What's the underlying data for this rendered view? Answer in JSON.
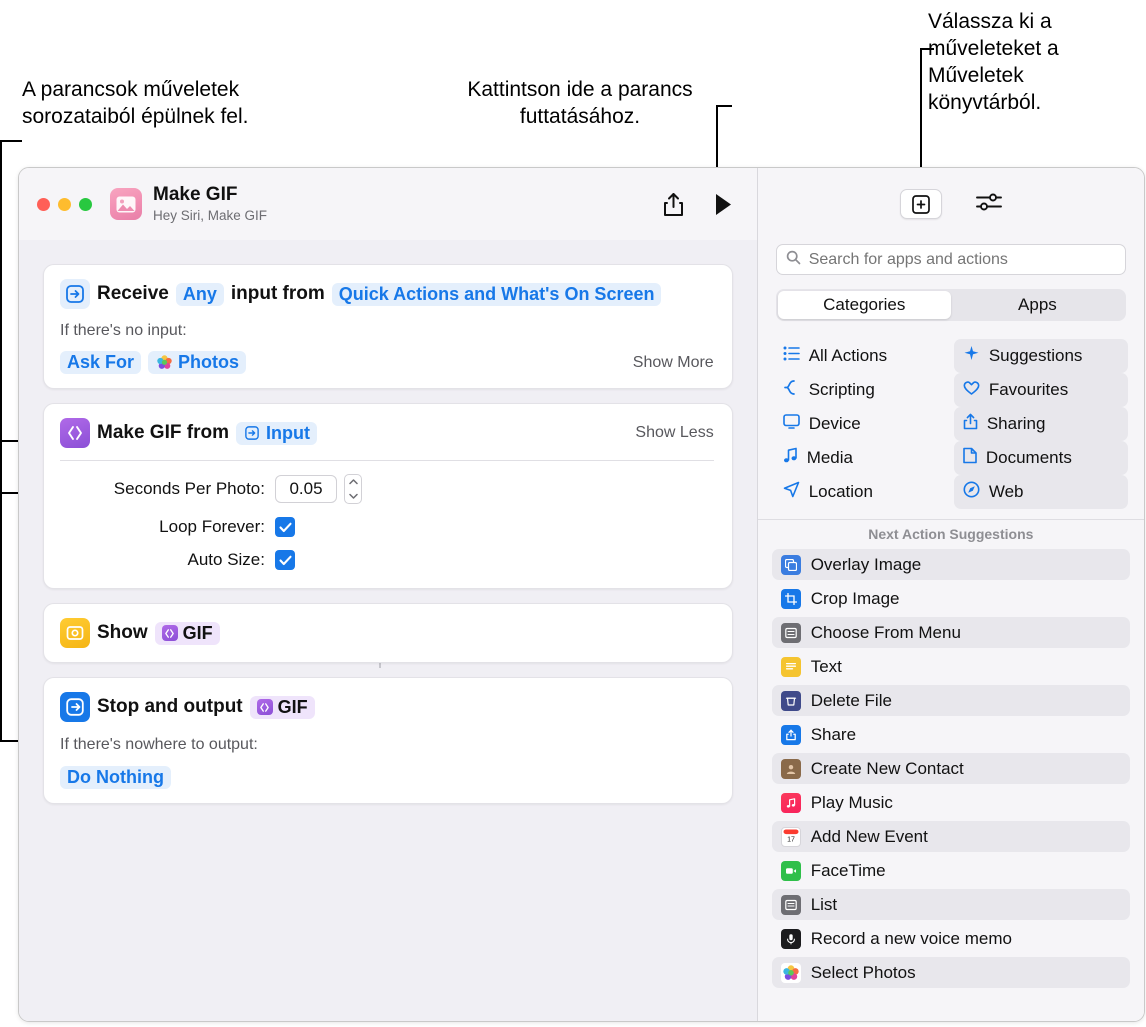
{
  "callouts": {
    "left": "A parancsok műveletek sorozataiból épülnek fel.",
    "middle": "Kattintson ide a parancs futtatásához.",
    "right": "Válassza ki a műveleteket a Műveletek könyvtárból."
  },
  "window": {
    "title": "Make GIF",
    "subtitle": "Hey Siri, Make GIF",
    "icons": {
      "share": "share-icon",
      "run": "play-icon",
      "app": "make-gif-app-icon"
    }
  },
  "actions": [
    {
      "id": "receive",
      "icon": "receive-input-icon",
      "title": "Receive",
      "token1": "Any",
      "mid": "input from",
      "token2": "Quick Actions and What's On Screen",
      "sub_label": "If there's no input:",
      "chip1": "Ask For",
      "chip2": "Photos",
      "toggle": "Show More"
    },
    {
      "id": "make-gif",
      "icon": "make-gif-icon",
      "title": "Make GIF from",
      "token": "Input",
      "toggle": "Show Less",
      "fields": [
        {
          "label": "Seconds Per Photo:",
          "value": "0.05",
          "type": "number"
        },
        {
          "label": "Loop Forever:",
          "value": "checked",
          "type": "checkbox"
        },
        {
          "label": "Auto Size:",
          "value": "checked",
          "type": "checkbox"
        }
      ]
    },
    {
      "id": "show",
      "icon": "quick-look-icon",
      "title": "Show",
      "token": "GIF"
    },
    {
      "id": "stop-output",
      "icon": "stop-output-icon",
      "title": "Stop and output",
      "token": "GIF",
      "sub_label": "If there's nowhere to output:",
      "chip1": "Do Nothing"
    }
  ],
  "library": {
    "buttons": {
      "add_action": "action-library-button",
      "details": "shortcut-details-button"
    },
    "search": {
      "placeholder": "Search for apps and actions",
      "icon": "search-icon",
      "value": ""
    },
    "segments": [
      {
        "label": "Categories",
        "active": true
      },
      {
        "label": "Apps",
        "active": false
      }
    ],
    "categories": [
      {
        "label": "All Actions",
        "icon": "list-icon",
        "highlight": false
      },
      {
        "label": "Suggestions",
        "icon": "sparkle-icon",
        "highlight": true
      },
      {
        "label": "Scripting",
        "icon": "scripting-icon",
        "highlight": false
      },
      {
        "label": "Favourites",
        "icon": "heart-icon",
        "highlight": true
      },
      {
        "label": "Device",
        "icon": "display-icon",
        "highlight": false
      },
      {
        "label": "Sharing",
        "icon": "share-icon",
        "highlight": true
      },
      {
        "label": "Media",
        "icon": "music-note-icon",
        "highlight": false
      },
      {
        "label": "Documents",
        "icon": "document-icon",
        "highlight": true
      },
      {
        "label": "Location",
        "icon": "location-icon",
        "highlight": false
      },
      {
        "label": "Web",
        "icon": "compass-icon",
        "highlight": true
      }
    ],
    "suggestions_header": "Next Action Suggestions",
    "suggestions": [
      {
        "label": "Overlay Image",
        "icon": "overlay-image-icon",
        "color": "#3b7de0",
        "shade": true
      },
      {
        "label": "Crop Image",
        "icon": "crop-image-icon",
        "color": "#1778e8",
        "shade": false
      },
      {
        "label": "Choose From Menu",
        "icon": "menu-icon",
        "color": "#6e6e73",
        "shade": true
      },
      {
        "label": "Text",
        "icon": "text-icon",
        "color": "#f5c430",
        "shade": false
      },
      {
        "label": "Delete File",
        "icon": "delete-file-icon",
        "color": "#3f4a8a",
        "shade": true
      },
      {
        "label": "Share",
        "icon": "share-icon",
        "color": "#1778e8",
        "shade": false
      },
      {
        "label": "Create New Contact",
        "icon": "contact-icon",
        "color": "#8a6a4a",
        "shade": true
      },
      {
        "label": "Play Music",
        "icon": "music-icon",
        "color": "#fa2a55",
        "shade": false
      },
      {
        "label": "Add New Event",
        "icon": "calendar-icon",
        "color": "#ffffff",
        "shade": true
      },
      {
        "label": "FaceTime",
        "icon": "facetime-icon",
        "color": "#2fbf4a",
        "shade": false
      },
      {
        "label": "List",
        "icon": "list-icon",
        "color": "#6e6e73",
        "shade": true
      },
      {
        "label": "Record a new voice memo",
        "icon": "voice-memo-icon",
        "color": "#1c1c1e",
        "shade": false
      },
      {
        "label": "Select Photos",
        "icon": "photos-icon",
        "color": "#ffffff",
        "shade": true
      }
    ]
  }
}
